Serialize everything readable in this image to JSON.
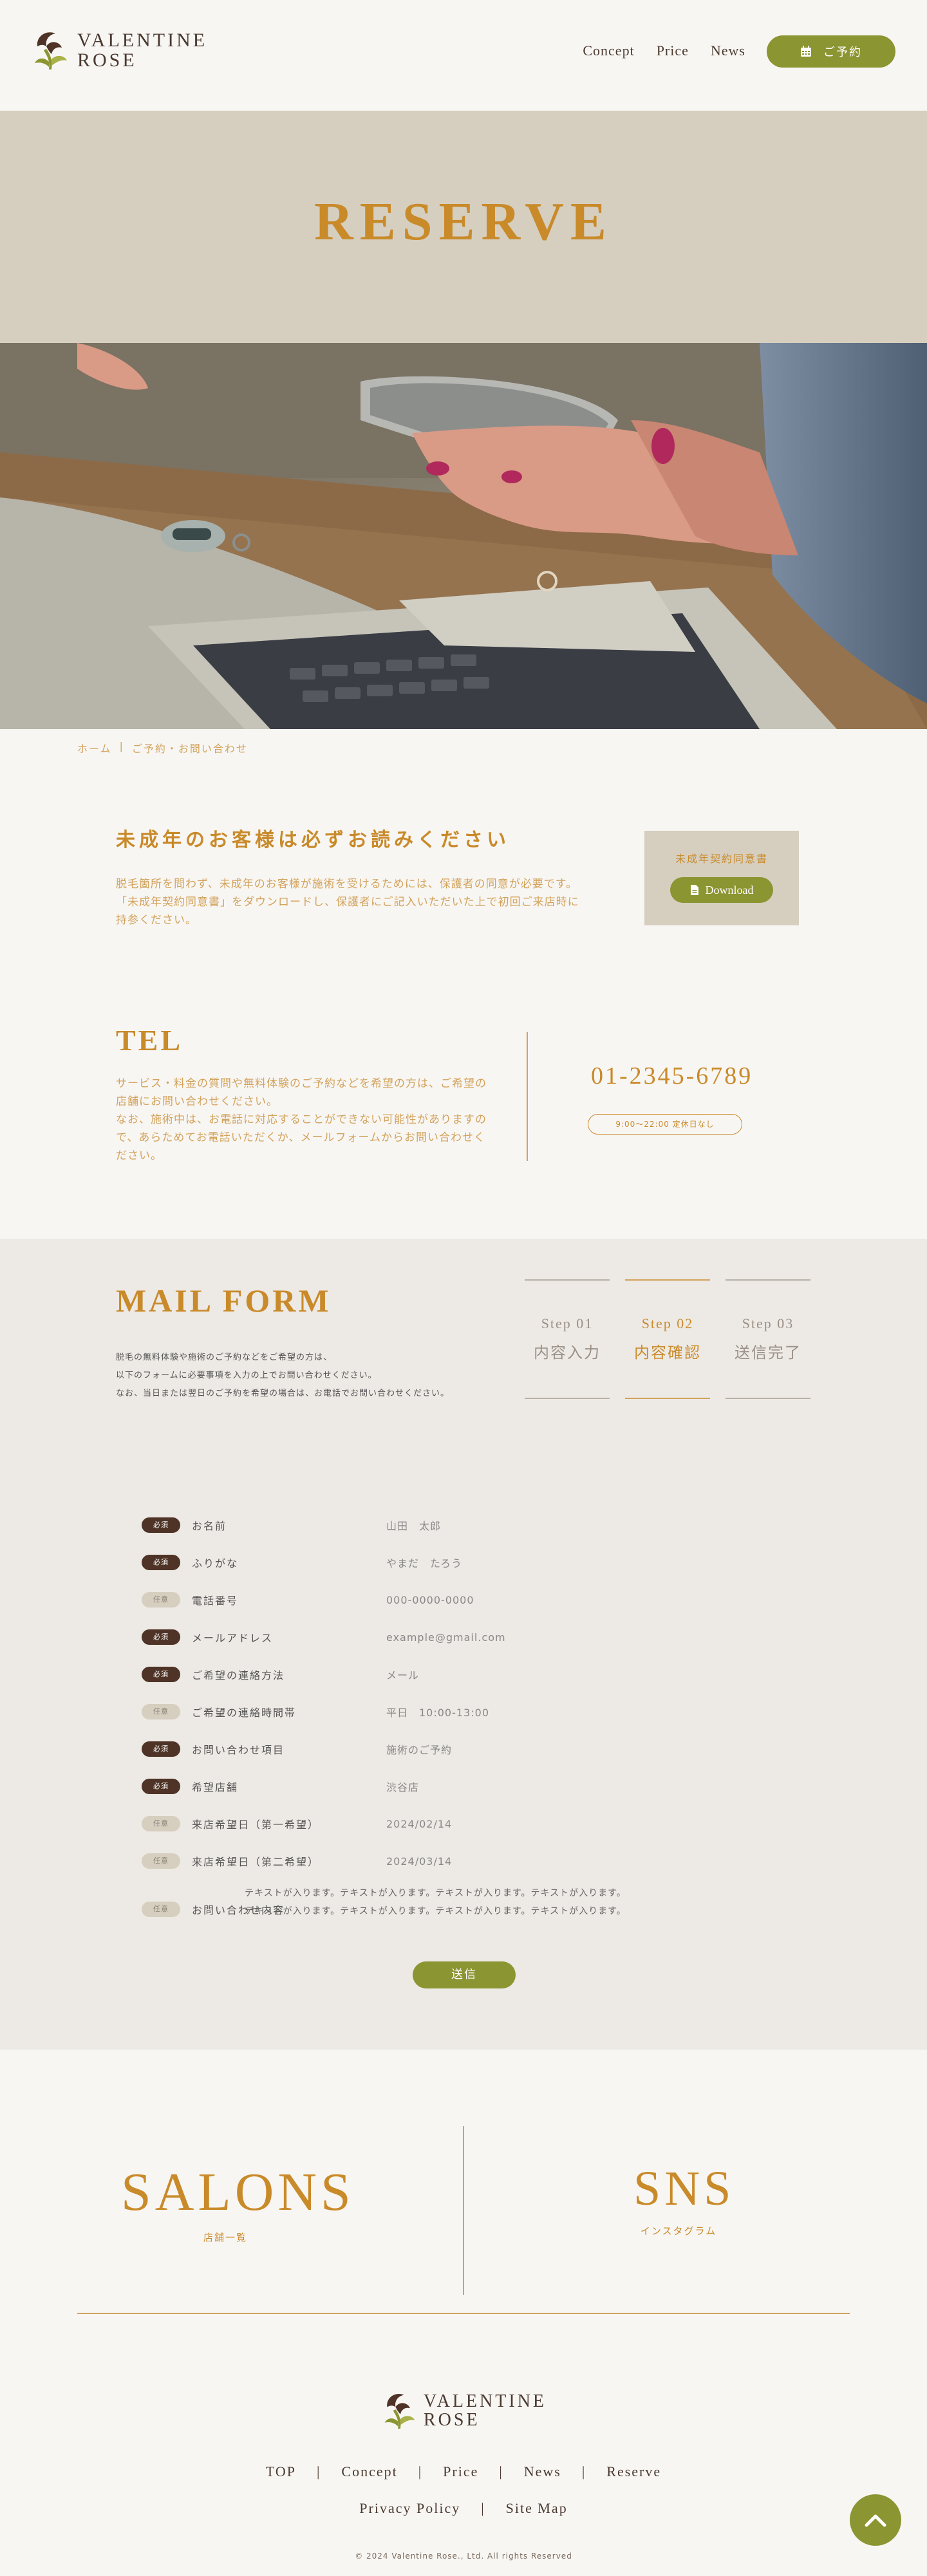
{
  "header": {
    "logo_line1": "VALENTINE",
    "logo_line2": "ROSE",
    "nav": [
      "Concept",
      "Price",
      "News"
    ],
    "reserve_label": "ご予約",
    "reserve_icon": "calendar-icon"
  },
  "hero": {
    "title": "RESERVE",
    "photo_alt": "hands holding smartphone over laptop"
  },
  "breadcrumb": {
    "home": "ホーム",
    "current": "ご予約・お問い合わせ"
  },
  "notice": {
    "title": "未成年のお客様は必ずお読みください",
    "text1": "脱毛箇所を問わず、未成年のお客様が施術を受けるためには、保護者の同意が必要です。",
    "text2": "「未成年契約同意書」をダウンロードし、保護者にご記入いただいた上で初回ご来店時に持参ください。",
    "download_label": "未成年契約同意書",
    "download_button": "Download",
    "download_icon": "file-icon"
  },
  "tel": {
    "title": "TEL",
    "text1": "サービス・料金の質問や無料体験のご予約などを希望の方は、ご希望の店舗にお問い合わせください。",
    "text2": "なお、施術中は、お電話に対応することができない可能性がありますので、あらためてお電話いただくか、メールフォームからお問い合わせください。",
    "number": "01-2345-6789",
    "hours": "9:00～22:00 定休日なし"
  },
  "mail": {
    "title": "MAIL FORM",
    "intro": [
      "脱毛の無料体験や施術のご予約などをご希望の方は、",
      "以下のフォームに必要事項を入力の上でお問い合わせください。",
      "なお、当日または翌日のご予約を希望の場合は、お電話でお問い合わせください。"
    ],
    "steps": [
      {
        "num": "Step 01",
        "label": "内容入力"
      },
      {
        "num": "Step 02",
        "label": "内容確認"
      },
      {
        "num": "Step 03",
        "label": "送信完了"
      }
    ],
    "badge_required": "必須",
    "badge_optional": "任意",
    "fields": [
      {
        "label": "お名前",
        "value": "山田　太郎"
      },
      {
        "label": "ふりがな",
        "value": "やまだ　たろう"
      },
      {
        "label": "電話番号",
        "value": "000-0000-0000"
      },
      {
        "label": "メールアドレス",
        "value": "example@gmail.com"
      },
      {
        "label": "ご希望の連絡方法",
        "value": "メール"
      },
      {
        "label": "ご希望の連絡時間帯",
        "value": "平日　10:00-13:00"
      },
      {
        "label": "お問い合わせ項目",
        "value": "施術のご予約"
      },
      {
        "label": "希望店舗",
        "value": "渋谷店"
      },
      {
        "label": "来店希望日（第一希望）",
        "value": "2024/02/14"
      },
      {
        "label": "来店希望日（第二希望）",
        "value": "2024/03/14"
      },
      {
        "label": "お問い合わせ内容",
        "value": "テキストが入ります。テキストが入ります。テキストが入ります。テキストが入ります。テキストが入ります。テキストが入ります。テキストが入ります。テキストが入ります。"
      }
    ],
    "submit": "送信"
  },
  "salons": {
    "title": "SALONS",
    "sub": "店舗一覧"
  },
  "sns": {
    "title": "SNS",
    "sub": "インスタグラム"
  },
  "footer": {
    "logo_line1": "VALENTINE",
    "logo_line2": "ROSE",
    "nav1": [
      "TOP",
      "Concept",
      "Price",
      "News",
      "Reserve"
    ],
    "nav2": [
      "Privacy Policy",
      "Site Map"
    ],
    "copyright": "© 2024 Valentine Rose., Ltd. All rights Reserved",
    "pagetop_icon": "chevron-up-icon"
  }
}
